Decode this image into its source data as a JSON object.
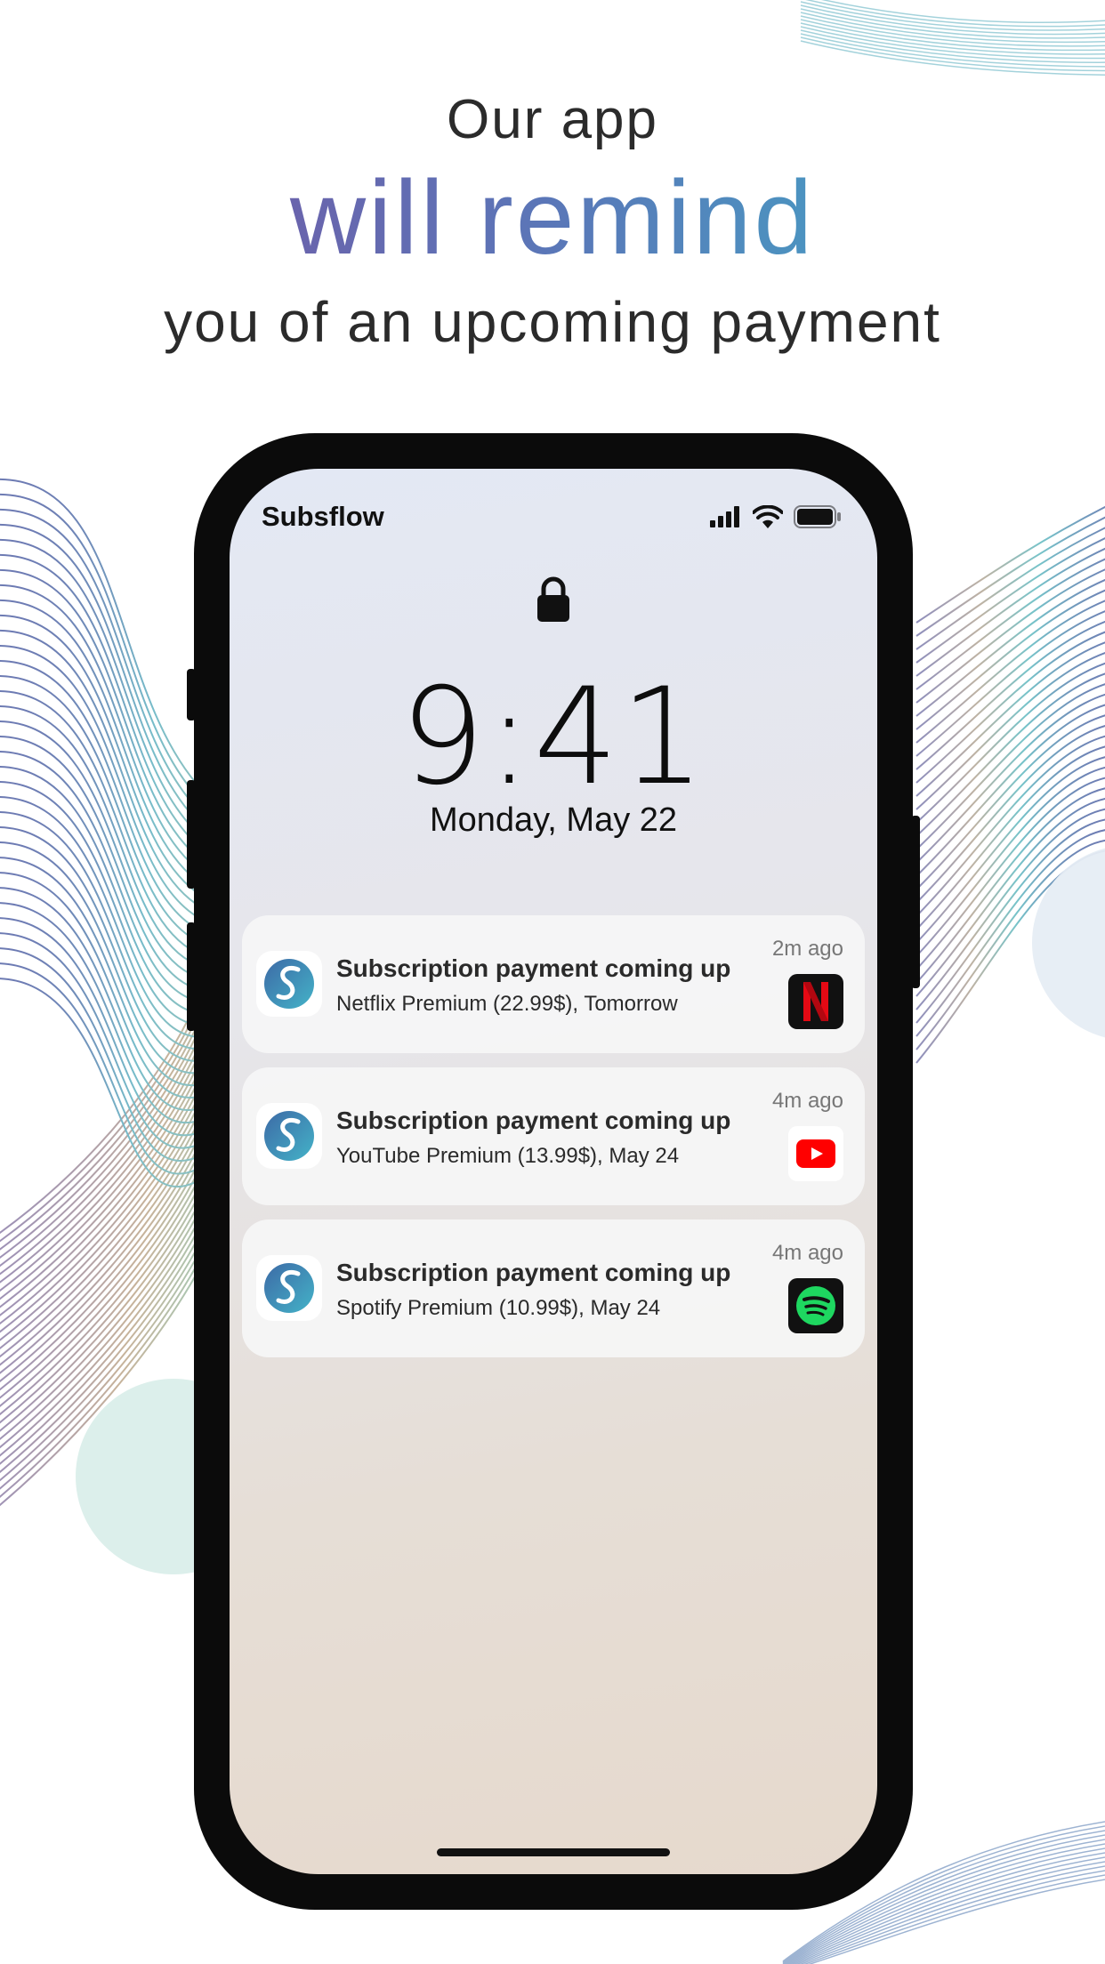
{
  "headline": {
    "line1": "Our app",
    "line2": "will remind",
    "line3": "you of an upcoming payment"
  },
  "status_bar": {
    "carrier": "Subsflow",
    "icons": [
      "signal-icon",
      "wifi-icon",
      "battery-icon"
    ]
  },
  "lock_screen": {
    "time": "9:41",
    "date": "Monday, May 22"
  },
  "notifications": [
    {
      "title": "Subscription payment coming up",
      "body": "Netflix Premium (22.99$), Tomorrow",
      "time": "2m ago",
      "service_icon": "netflix-icon"
    },
    {
      "title": "Subscription payment coming up",
      "body": "YouTube Premium (13.99$), May 24",
      "time": "4m ago",
      "service_icon": "youtube-icon"
    },
    {
      "title": "Subscription payment coming up",
      "body": "Spotify Premium (10.99$), May 24",
      "time": "4m ago",
      "service_icon": "spotify-icon"
    }
  ],
  "colors": {
    "gradient_start": "#7a4fa0",
    "gradient_end": "#3bb3c9",
    "phone_frame": "#0b0b0b",
    "netflix": "#e50914",
    "youtube": "#ff0000",
    "spotify": "#1ed760"
  }
}
